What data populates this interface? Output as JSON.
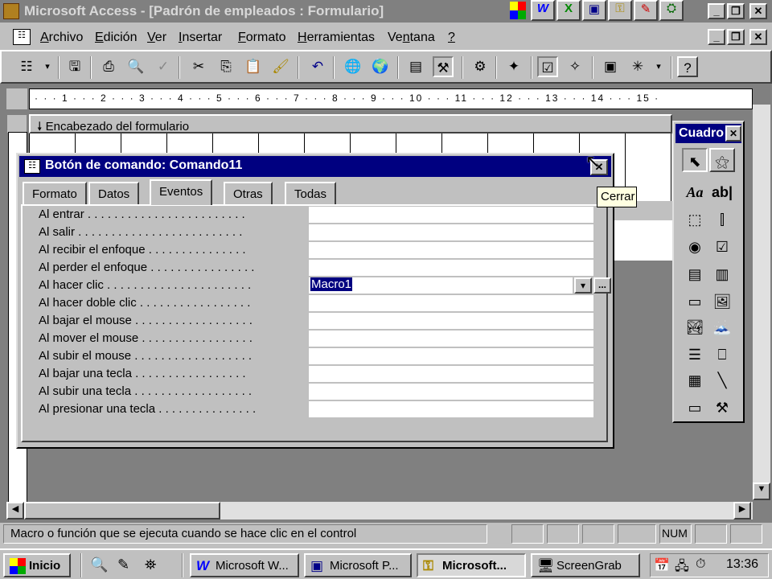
{
  "window": {
    "title": "Microsoft Access - [Padrón de empleados : Formulario]"
  },
  "menu": {
    "items": [
      "Archivo",
      "Edición",
      "Ver",
      "Insertar",
      "Formato",
      "Herramientas",
      "Ventana",
      "?"
    ],
    "underline": [
      "A",
      "E",
      "V",
      "I",
      "F",
      "H",
      "n",
      "?"
    ]
  },
  "section": {
    "header_label": "Encabezado del formulario"
  },
  "ruler": {
    "marks": "· · · 1 · · · 2 · · · 3 · · · 4 · · · 5 · · · 6 · · · 7 · · · 8 · · · 9 · · · 10 · · · 11 · · · 12 · · · 13 · · · 14 · · · 15 ·"
  },
  "props": {
    "title": "Botón de comando: Comando11",
    "tabs": [
      "Formato",
      "Datos",
      "Eventos",
      "Otras",
      "Todas"
    ],
    "active_tab": "Eventos",
    "rows": [
      {
        "label": "Al entrar . . . . . . . . . . . . . . . . . . . . . . . .",
        "value": ""
      },
      {
        "label": "Al salir . . . . . . . . . . . . . . . . . . . . . . . . .",
        "value": ""
      },
      {
        "label": "Al recibir el enfoque . . . . . . . . . . . . . . .",
        "value": ""
      },
      {
        "label": "Al perder el enfoque . . . . . . . . . . . . . . . .",
        "value": ""
      },
      {
        "label": "Al hacer clic . . . . . . . . . . . . . . . . . . . . . .",
        "value": "Macro1"
      },
      {
        "label": "Al hacer doble clic . . . . . . . . . . . . . . . . .",
        "value": ""
      },
      {
        "label": "Al bajar el mouse . . . . . . . . . . . . . . . . . .",
        "value": ""
      },
      {
        "label": "Al mover el mouse . . . . . . . . . . . . . . . . .",
        "value": ""
      },
      {
        "label": "Al subir el mouse . . . . . . . . . . . . . . . . . .",
        "value": ""
      },
      {
        "label": "Al bajar una tecla . . . . . . . . . . . . . . . . .",
        "value": ""
      },
      {
        "label": "Al subir una tecla . . . . . . . . . . . . . . . . . .",
        "value": ""
      },
      {
        "label": "Al presionar una tecla . . . . . . . . . . . . . . .",
        "value": ""
      }
    ],
    "builder_label": "...",
    "dropdown_glyph": "▾"
  },
  "tooltip": {
    "text": "Cerrar"
  },
  "toolbox": {
    "title": "Cuadro",
    "label_tool": "Aa",
    "textbox_tool": "ab|"
  },
  "status": {
    "message": "Macro o función que se ejecuta cuando se hace clic en el control",
    "num": "NUM"
  },
  "taskbar": {
    "start": "Inicio",
    "buttons": [
      "Microsoft W...",
      "Microsoft P...",
      "Microsoft...",
      "ScreenGrab"
    ],
    "clock": "13:36"
  },
  "colors": {
    "titlebar_active": "#000080",
    "titlebar_inactive": "#808080",
    "face": "#c0c0c0"
  }
}
